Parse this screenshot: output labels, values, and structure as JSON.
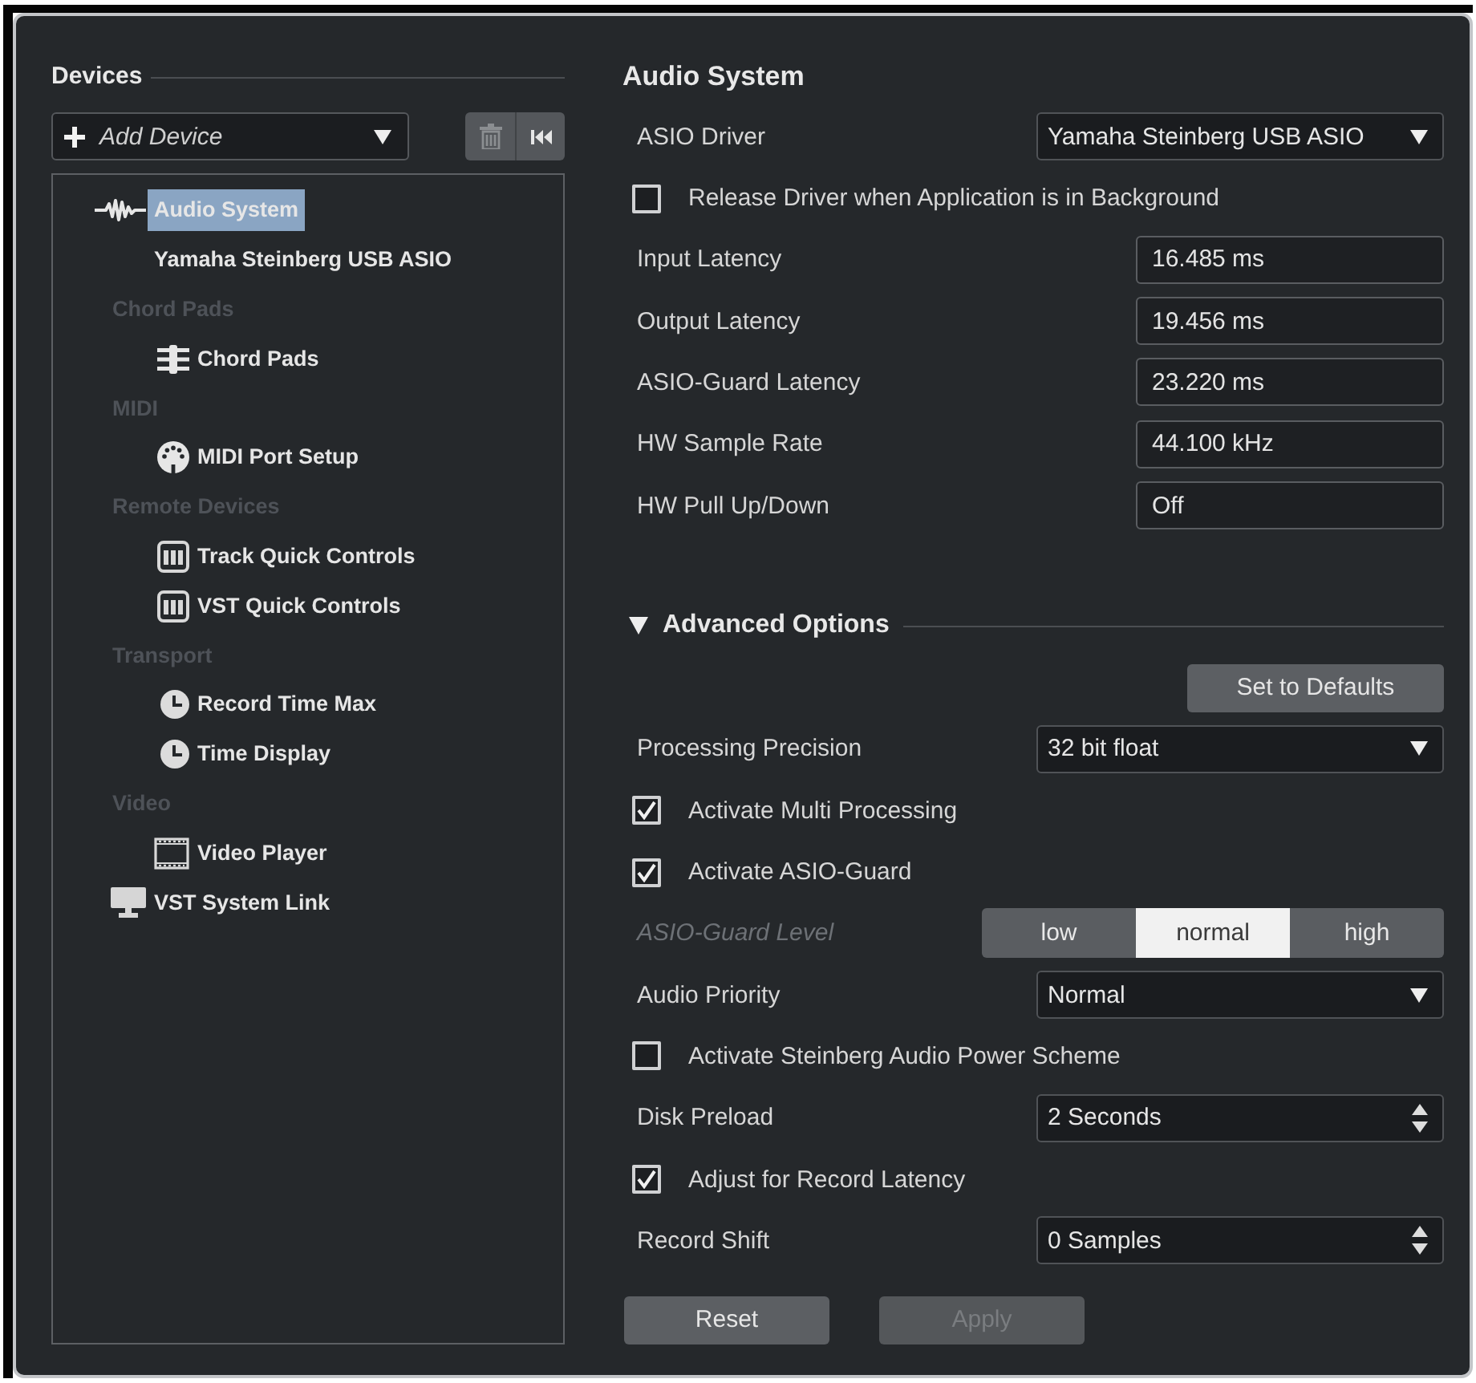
{
  "devices": {
    "title": "Devices",
    "add_device": {
      "label": "Add Device"
    },
    "tool_buttons": [
      {
        "kind": "delete",
        "disabled": true
      },
      {
        "kind": "reset",
        "disabled": false
      }
    ],
    "tree": [
      {
        "kind": "wave",
        "label": "Audio System",
        "selected": true,
        "children": [
          {
            "kind": "plain",
            "label": "Yamaha Steinberg USB ASIO",
            "selected": false
          }
        ]
      },
      {
        "kind": "category",
        "label": "Chord Pads",
        "selected": false,
        "children": [
          {
            "kind": "pads",
            "label": "Chord Pads",
            "selected": false
          }
        ]
      },
      {
        "kind": "category",
        "label": "MIDI",
        "selected": false,
        "children": [
          {
            "kind": "port",
            "label": "MIDI Port Setup",
            "selected": false
          }
        ]
      },
      {
        "kind": "category",
        "label": "Remote Devices",
        "selected": false,
        "children": [
          {
            "kind": "keys",
            "label": "Track Quick Controls",
            "selected": false
          },
          {
            "kind": "keys",
            "label": "VST Quick Controls",
            "selected": false
          }
        ]
      },
      {
        "kind": "category",
        "label": "Transport",
        "selected": false,
        "children": [
          {
            "kind": "clock",
            "label": "Record Time Max",
            "selected": false
          },
          {
            "kind": "clock",
            "label": "Time Display",
            "selected": false
          }
        ]
      },
      {
        "kind": "category",
        "label": "Video",
        "selected": false,
        "children": [
          {
            "kind": "film",
            "label": "Video Player",
            "selected": false
          }
        ]
      },
      {
        "kind": "monitor",
        "label": "VST System Link",
        "selected": false
      }
    ]
  },
  "audio_system": {
    "title": "Audio System",
    "settings": [
      {
        "kind": "dropdown",
        "label": "ASIO Driver",
        "value": "Yamaha Steinberg USB ASIO"
      },
      {
        "kind": "checkbox",
        "label": "Release Driver when Application is in Background",
        "checked": false
      },
      {
        "kind": "field",
        "label": "Input Latency",
        "value": "16.485 ms"
      },
      {
        "kind": "field",
        "label": "Output Latency",
        "value": "19.456 ms"
      },
      {
        "kind": "field",
        "label": "ASIO-Guard Latency",
        "value": "23.220 ms"
      },
      {
        "kind": "field",
        "label": "HW Sample Rate",
        "value": "44.100 kHz"
      },
      {
        "kind": "field",
        "label": "HW Pull Up/Down",
        "value": "Off"
      }
    ]
  },
  "advanced_options": {
    "title": "Advanced Options",
    "expanded": true,
    "defaults_button": {
      "label": "Set to Defaults"
    },
    "settings": [
      {
        "kind": "dropdown",
        "label": "Processing Precision",
        "value": "32 bit float"
      },
      {
        "kind": "checkbox",
        "label": "Activate Multi Processing",
        "checked": true
      },
      {
        "kind": "checkbox",
        "label": "Activate ASIO-Guard",
        "checked": true
      },
      {
        "kind": "segmented",
        "label": "ASIO-Guard Level",
        "dimmed": true,
        "options": [
          {
            "label": "low",
            "selected": false
          },
          {
            "label": "normal",
            "selected": true
          },
          {
            "label": "high",
            "selected": false
          }
        ]
      },
      {
        "kind": "dropdown",
        "label": "Audio Priority",
        "value": "Normal"
      },
      {
        "kind": "checkbox",
        "label": "Activate Steinberg Audio Power Scheme",
        "checked": false
      },
      {
        "kind": "spinbox",
        "label": "Disk Preload",
        "value": "2 Seconds"
      },
      {
        "kind": "checkbox",
        "label": "Adjust for Record Latency",
        "checked": true
      },
      {
        "kind": "spinbox",
        "label": "Record Shift",
        "value": "0 Samples"
      }
    ]
  },
  "buttons": [
    {
      "label": "Reset",
      "disabled": false
    },
    {
      "label": "Apply",
      "disabled": true
    }
  ]
}
